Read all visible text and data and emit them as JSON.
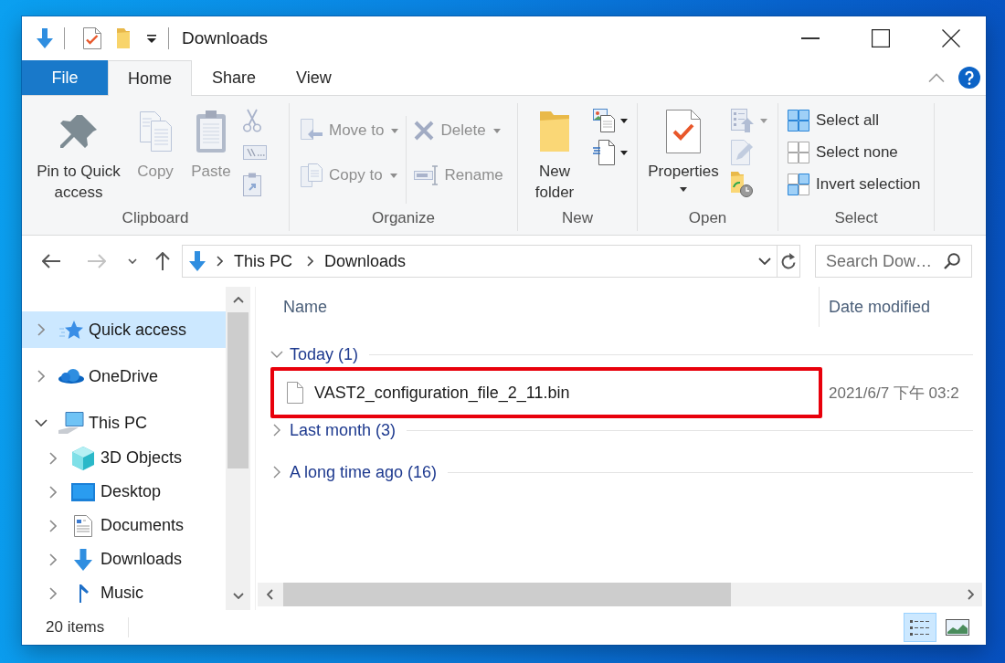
{
  "window": {
    "title": "Downloads"
  },
  "ribbon_tabs": [
    {
      "label": "File",
      "kind": "menu",
      "selected": false
    },
    {
      "label": "Home",
      "kind": "tab",
      "selected": true
    },
    {
      "label": "Share",
      "kind": "tab",
      "selected": false
    },
    {
      "label": "View",
      "kind": "tab",
      "selected": false
    }
  ],
  "ribbon": {
    "groups": [
      {
        "label": "Clipboard",
        "columns": [
          [
            {
              "kind": "large",
              "label": "Pin to Quick access",
              "disabled": false
            }
          ],
          [
            {
              "kind": "large",
              "label": "Copy",
              "disabled": true
            }
          ],
          [
            {
              "kind": "large",
              "label": "Paste",
              "disabled": true
            }
          ],
          [
            {
              "kind": "icon",
              "disabled": true
            },
            {
              "kind": "icon",
              "disabled": true
            },
            {
              "kind": "icon",
              "disabled": true
            }
          ]
        ]
      },
      {
        "label": "Organize",
        "columns": [
          [
            {
              "kind": "small",
              "label": "Move to",
              "disabled": true,
              "dropdown": true
            },
            {
              "kind": "small",
              "label": "Copy to",
              "disabled": true,
              "dropdown": true
            }
          ],
          [
            {
              "kind": "small",
              "label": "Delete",
              "disabled": true,
              "dropdown": true
            },
            {
              "kind": "small",
              "label": "Rename",
              "disabled": true
            }
          ]
        ]
      },
      {
        "label": "New",
        "columns": [
          [
            {
              "kind": "large",
              "label": "New folder",
              "disabled": false
            }
          ],
          [
            {
              "kind": "icon",
              "disabled": false,
              "dropdown": true
            },
            {
              "kind": "icon",
              "disabled": false,
              "dropdown": true
            }
          ]
        ]
      },
      {
        "label": "Open",
        "columns": [
          [
            {
              "kind": "large",
              "label": "Properties",
              "disabled": false,
              "dropdown": true
            }
          ],
          [
            {
              "kind": "icon",
              "disabled": true,
              "dropdown": true
            },
            {
              "kind": "icon",
              "disabled": true
            },
            {
              "kind": "icon",
              "disabled": false
            }
          ]
        ]
      },
      {
        "label": "Select",
        "columns": [
          [
            {
              "kind": "small",
              "label": "Select all",
              "disabled": false
            },
            {
              "kind": "small",
              "label": "Select none",
              "disabled": false
            },
            {
              "kind": "small",
              "label": "Invert selection",
              "disabled": false
            }
          ]
        ]
      }
    ]
  },
  "nav_buttons": [
    {
      "disabled": false
    },
    {
      "disabled": true
    },
    {
      "disabled": false
    },
    {
      "disabled": false
    }
  ],
  "address_bar": {
    "path": [
      "This PC",
      "Downloads"
    ]
  },
  "search": {
    "placeholder": "Search Dow…"
  },
  "navigation": {
    "items": [
      {
        "label": "Quick access",
        "selected": true,
        "expanded": false
      },
      {
        "label": "OneDrive",
        "selected": false,
        "expanded": false
      },
      {
        "label": "This PC",
        "selected": false,
        "expanded": true,
        "children": [
          {
            "label": "3D Objects",
            "selected": false,
            "expanded": false
          },
          {
            "label": "Desktop",
            "selected": false,
            "expanded": false
          },
          {
            "label": "Documents",
            "selected": false,
            "expanded": false
          },
          {
            "label": "Downloads",
            "selected": false,
            "expanded": false
          },
          {
            "label": "Music",
            "selected": false,
            "expanded": false
          }
        ]
      }
    ]
  },
  "file_list": {
    "columns": [
      "Name",
      "Date modified"
    ],
    "groups": [
      {
        "label": "Today (1)",
        "expanded": true,
        "files": [
          {
            "name": "VAST2_configuration_file_2_11.bin",
            "date_modified": "2021/6/7 下午 03:2",
            "highlighted": true
          }
        ]
      },
      {
        "label": "Last month (3)",
        "expanded": false
      },
      {
        "label": "A long time ago (16)",
        "expanded": false
      }
    ]
  },
  "status_bar": {
    "item_count": "20 items",
    "views": [
      {
        "selected": true
      },
      {
        "selected": false
      }
    ]
  }
}
